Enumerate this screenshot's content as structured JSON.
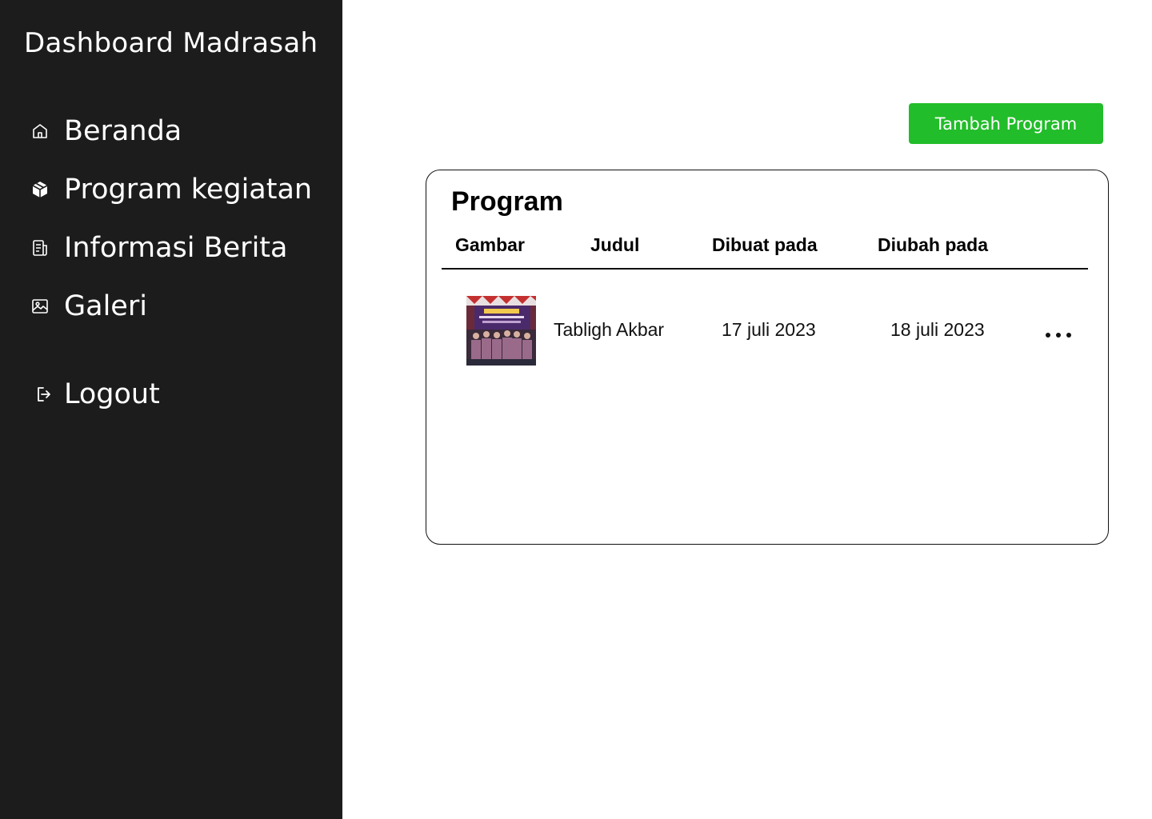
{
  "sidebar": {
    "title": "Dashboard Madrasah",
    "items": [
      {
        "label": "Beranda",
        "icon": "home-icon"
      },
      {
        "label": "Program kegiatan",
        "icon": "box-icon"
      },
      {
        "label": "Informasi Berita",
        "icon": "news-icon"
      },
      {
        "label": "Galeri",
        "icon": "image-icon"
      }
    ],
    "logout": {
      "label": "Logout",
      "icon": "logout-icon"
    }
  },
  "toolbar": {
    "add_label": "Tambah Program",
    "add_color": "#22bd2a"
  },
  "program": {
    "title": "Program",
    "columns": [
      "Gambar",
      "Judul",
      "Dibuat pada",
      "Diubah pada"
    ],
    "rows": [
      {
        "title": "Tabligh Akbar",
        "created": "17 juli 2023",
        "updated": "18 juli 2023"
      }
    ]
  },
  "colors": {
    "sidebar_bg": "#1c1c1c",
    "accent": "#22bd2a"
  }
}
